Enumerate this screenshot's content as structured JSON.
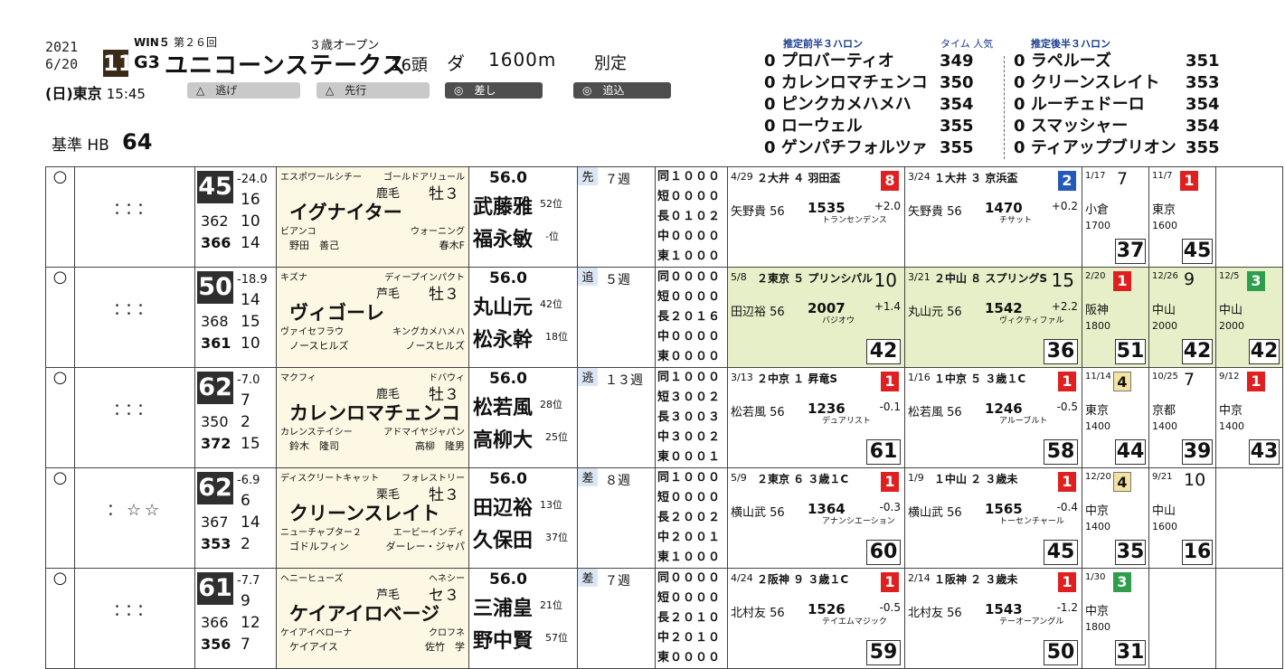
{
  "header": {
    "year": "2021",
    "date": "6/20",
    "win5": "WIN５",
    "round": "第２６回",
    "race_no": "11",
    "grade": "G3",
    "race_class": "３歳オープン",
    "race_name": "ユニコーンステークス",
    "field": "16頭",
    "surface": "ダ",
    "distance": "1600m",
    "weight_rule": "別定",
    "day": "(日)",
    "venue": "東京",
    "time": "15:45",
    "standard_label": "基準 HB",
    "standard_value": "64",
    "styles": [
      "△　逃げ",
      "△　先行",
      "◎　差し",
      "◎　追込"
    ]
  },
  "estimate": {
    "front_title": "推定前半３ハロン",
    "cols": "タイム 人気",
    "rear_title": "推定後半３ハロン",
    "front": [
      {
        "n": "0",
        "name": "プロバーティオ",
        "t": "349"
      },
      {
        "n": "0",
        "name": "カレンロマチェンコ",
        "t": "350"
      },
      {
        "n": "0",
        "name": "ピンクカメハメハ",
        "t": "354"
      },
      {
        "n": "0",
        "name": "ローウェル",
        "t": "355"
      },
      {
        "n": "0",
        "name": "ゲンパチフォルツァ",
        "t": "355"
      }
    ],
    "rear": [
      {
        "n": "0",
        "name": "ラペルーズ",
        "t": "351"
      },
      {
        "n": "0",
        "name": "クリーンスレイト",
        "t": "353"
      },
      {
        "n": "0",
        "name": "ルーチェドーロ",
        "t": "354"
      },
      {
        "n": "0",
        "name": "スマッシャー",
        "t": "354"
      },
      {
        "n": "0",
        "name": "ティアップブリオン",
        "t": "355"
      }
    ]
  },
  "horses": [
    {
      "mark": "○",
      "dots": "：：：",
      "score": "45",
      "idx": "-24.0",
      "a": "16",
      "b": "362",
      "c": "10",
      "d": "366",
      "e": "14",
      "sire": "エスポワールシチー",
      "dam_sire": "ゴールドアリュール",
      "coat": "鹿毛",
      "sex": "牡３",
      "name": "イグナイター",
      "dam": "ビアンコ",
      "dam2": "ウォーニング",
      "owner": "野田　善己",
      "breeder": "春木F",
      "weight": "56.0",
      "style": "先",
      "jockey": "武藤雅",
      "jpos": "52",
      "trainer": "福永敏",
      "tpos": "-",
      "weeks": "７週",
      "rec": [
        "同１０００",
        "短００００",
        "長０１０２",
        "中００００",
        "東１０００"
      ],
      "p1": {
        "date": "4/29",
        "txt": "２大井 ４ 羽田盃",
        "rank": "8",
        "jock": "矢野貴 56",
        "time": "1535",
        "rival": "トランセンデンス",
        "dif": "+2.0",
        "cls": "red"
      },
      "p2": {
        "date": "3/24",
        "txt": "１大井 ３ 京浜盃",
        "rank": "2",
        "jock": "矢野貴 56",
        "time": "1470",
        "rival": "チサット",
        "dif": "+0.2",
        "cls": "blue"
      },
      "m1": {
        "d": "1/17",
        "r": "7",
        "v": "小倉",
        "g": "1700",
        "big": "37"
      },
      "m2": {
        "d": "11/7",
        "r": "1",
        "v": "東京",
        "g": "1600",
        "big": "45"
      }
    },
    {
      "mark": "○",
      "dots": "：：：",
      "score": "50",
      "idx": "-18.9",
      "a": "14",
      "b": "368",
      "c": "15",
      "d": "361",
      "e": "10",
      "sire": "キズナ",
      "dam_sire": "ディープインパクト",
      "coat": "芦毛",
      "sex": "牡３",
      "name": "ヴィゴーレ",
      "dam": "ヴァイセフラウ",
      "dam2": "キングカメハメハ",
      "owner": "ノースヒルズ",
      "breeder": "ノースヒルズ",
      "weight": "56.0",
      "style": "追",
      "jockey": "丸山元",
      "jpos": "42",
      "trainer": "松永幹",
      "tpos": "18",
      "weeks": "５週",
      "rec": [
        "同００００",
        "短００００",
        "長２０１６",
        "中００００",
        "東００００"
      ],
      "p1": {
        "date": "5/8",
        "txt": "２東京 ５ プリンシパル",
        "rank": "10",
        "jock": "田辺裕 56",
        "time": "2007",
        "rival": "バジオウ",
        "dif": "+1.4",
        "cls": "plain",
        "big": "42"
      },
      "p2": {
        "date": "3/21",
        "txt": "２中山 ８ スプリングS",
        "rank": "15",
        "jock": "丸山元 56",
        "time": "1542",
        "rival": "ヴィクティファル",
        "dif": "+2.2",
        "cls": "plain",
        "big": "36"
      },
      "m1": {
        "d": "2/20",
        "r": "1",
        "v": "阪神",
        "g": "1800",
        "big": "51"
      },
      "m2": {
        "d": "12/26",
        "r": "9",
        "v": "中山",
        "g": "2000",
        "big": "42"
      },
      "m3": {
        "d": "12/5",
        "r": "3",
        "v": "中山",
        "g": "2000",
        "big": "42"
      }
    },
    {
      "mark": "○",
      "dots": "：：：",
      "score": "62",
      "idx": "-7.0",
      "a": "7",
      "b": "350",
      "c": "2",
      "d": "372",
      "e": "15",
      "sire": "マクフィ",
      "dam_sire": "ドバウィ",
      "coat": "鹿毛",
      "sex": "牡３",
      "name": "カレンロマチェンコ",
      "dam": "カレンステイシー",
      "dam2": "アドマイヤジャパン",
      "owner": "鈴木　隆司",
      "breeder": "高柳　隆男",
      "weight": "56.0",
      "style": "逃",
      "jockey": "松若風",
      "jpos": "28",
      "trainer": "高柳大",
      "tpos": "25",
      "weeks": "１３週",
      "rec": [
        "同１０００",
        "短３００２",
        "長３００３",
        "中３００２",
        "東０００１"
      ],
      "p1": {
        "date": "3/13",
        "txt": "２中京 １ 昇竜S",
        "rank": "1",
        "jock": "松若風 56",
        "time": "1236",
        "rival": "デュアリスト",
        "dif": "-0.1",
        "cls": "red",
        "big": "61"
      },
      "p2": {
        "date": "1/16",
        "txt": "１中京 ５ ３歳１C",
        "rank": "1",
        "jock": "松若風 56",
        "time": "1246",
        "rival": "アルーブルト",
        "dif": "-0.5",
        "cls": "red",
        "big": "58"
      },
      "m1": {
        "d": "11/14",
        "r": "4",
        "v": "東京",
        "g": "1400",
        "big": "44"
      },
      "m2": {
        "d": "10/25",
        "r": "7",
        "v": "京都",
        "g": "1400",
        "big": "39"
      },
      "m3": {
        "d": "9/12",
        "r": "1",
        "v": "中京",
        "g": "1400",
        "big": "43"
      }
    },
    {
      "mark": "○",
      "dots": "：☆☆",
      "score": "62",
      "idx": "-6.9",
      "a": "6",
      "b": "367",
      "c": "14",
      "d": "353",
      "e": "2",
      "sire": "ディスクリートキャット",
      "dam_sire": "フォレストリー",
      "coat": "栗毛",
      "sex": "牡３",
      "name": "クリーンスレイト",
      "dam": "ニューチャプター２",
      "dam2": "エービーインディ",
      "owner": "ゴドルフィン",
      "breeder": "ダーレー・ジャパ",
      "weight": "56.0",
      "style": "差",
      "jockey": "田辺裕",
      "jpos": "13",
      "trainer": "久保田",
      "tpos": "37",
      "weeks": "８週",
      "rec": [
        "同１０００",
        "短００００",
        "長２００２",
        "中２００１",
        "東１０００"
      ],
      "p1": {
        "date": "5/9",
        "txt": "２東京 ６ ３歳１C",
        "rank": "1",
        "jock": "横山武 56",
        "time": "1364",
        "rival": "アナンシエーション",
        "dif": "-0.3",
        "cls": "red",
        "big": "60"
      },
      "p2": {
        "date": "1/9",
        "txt": "１中山 ２ ３歳未",
        "rank": "1",
        "jock": "横山武 56",
        "time": "1565",
        "rival": "トーセンチャール",
        "dif": "-0.4",
        "cls": "red",
        "big": "45"
      },
      "m1": {
        "d": "12/20",
        "r": "4",
        "v": "中京",
        "g": "1400",
        "big": "35"
      },
      "m2": {
        "d": "9/21",
        "r": "10",
        "v": "中山",
        "g": "1600",
        "big": "16"
      }
    },
    {
      "mark": "○",
      "dots": "：：：",
      "score": "61",
      "idx": "-7.7",
      "a": "9",
      "b": "366",
      "c": "12",
      "d": "356",
      "e": "7",
      "sire": "ヘニーヒューズ",
      "dam_sire": "ヘネシー",
      "coat": "芦毛",
      "sex": "セ３",
      "name": "ケイアイロベージ",
      "dam": "ケイアイベローナ",
      "dam2": "クロフネ",
      "owner": "ケイアイス",
      "breeder": "佐竹　学",
      "weight": "56.0",
      "style": "差",
      "jockey": "三浦皇",
      "jpos": "21",
      "trainer": "野中賢",
      "tpos": "57",
      "weeks": "７週",
      "rec": [
        "同００００",
        "短００００",
        "長２０１０",
        "中２０１０",
        "東００００"
      ],
      "p1": {
        "date": "4/24",
        "txt": "２阪神 ９ ３歳１C",
        "rank": "1",
        "jock": "北村友 56",
        "time": "1526",
        "rival": "テイエムマジック",
        "dif": "-0.5",
        "cls": "red",
        "big": "59"
      },
      "p2": {
        "date": "2/14",
        "txt": "１阪神 ２ ３歳未",
        "rank": "1",
        "jock": "北村友 56",
        "time": "1543",
        "rival": "テーオーアングル",
        "dif": "-1.2",
        "cls": "red",
        "big": "50"
      },
      "m1": {
        "d": "1/30",
        "r": "3",
        "v": "中京",
        "g": "1800",
        "big": "31"
      }
    }
  ]
}
